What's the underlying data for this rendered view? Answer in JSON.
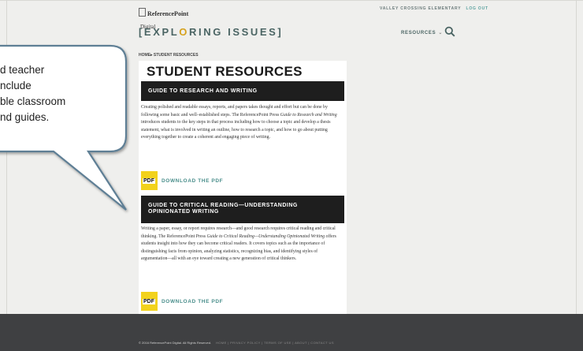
{
  "header": {
    "logo_brand": "ReferencePoint",
    "logo_sub": "Digital",
    "site_title_pre": "[EXPL",
    "site_title_o": "O",
    "site_title_post": "RING ISSUES]",
    "school_name": "VALLEY CROSSING ELEMENTARY",
    "logout_label": "LOG OUT",
    "nav_resources": "RESOURCES",
    "nav_chevron": "⌄"
  },
  "breadcrumb": "HOME▸ STUDENT RESOURCES",
  "page_title": "STUDENT RESOURCES",
  "sections": [
    {
      "heading": "GUIDE TO RESEARCH AND WRITING",
      "text_a": "Creating polished and readable essays, reports, and papers takes thought and effort but can be done by following some basic and well–established steps. The ReferencePoint Press ",
      "text_italic": "Guide to Research and Writing",
      "text_b": " introduces students to the key steps in that process including how to choose a topic and develop a thesis statement, what is involved in writing an outline, how to research a topic, and how to go about putting everything together to create a coherent and engaging piece of writing.",
      "pdf_icon_label": "PDF",
      "download_label": "DOWNLOAD THE PDF"
    },
    {
      "heading_line1": "GUIDE TO CRITICAL READING—UNDERSTANDING",
      "heading_line2": "OPINIONATED WRITING",
      "text_a": "Writing a paper, essay, or report requires research—and good research requires critical reading and critical thinking. The ReferencePoint Press ",
      "text_italic": "Guide to Critical Reading—Understanding Opinionated Writing",
      "text_b": " offers students insight into how they can become critical readers. It covers topics such as the importance of distinguishing facts from opinion, analyzing statistics, recognizing bias, and identifying styles of argumentation—all with an eye toward creating a new generation of critical thinkers.",
      "pdf_icon_label": "PDF",
      "download_label": "DOWNLOAD THE PDF"
    }
  ],
  "footer": {
    "copyright": "© 2016 ReferencePoint Digital. All Rights Reserved.",
    "links": "HOME | PRIVACY POLICY | TERMS OF USE | ABOUT | CONTACT US"
  },
  "callout": {
    "line1": "d teacher",
    "line2": "nclude",
    "line3": "ble classroom",
    "line4": "nd guides."
  },
  "colors": {
    "accent_teal": "#4b8f8c",
    "title_slate": "#4b6564",
    "brand_yellow": "#d6a21e",
    "pdf_yellow": "#f2d21c",
    "footer_bg": "#3f4042"
  }
}
